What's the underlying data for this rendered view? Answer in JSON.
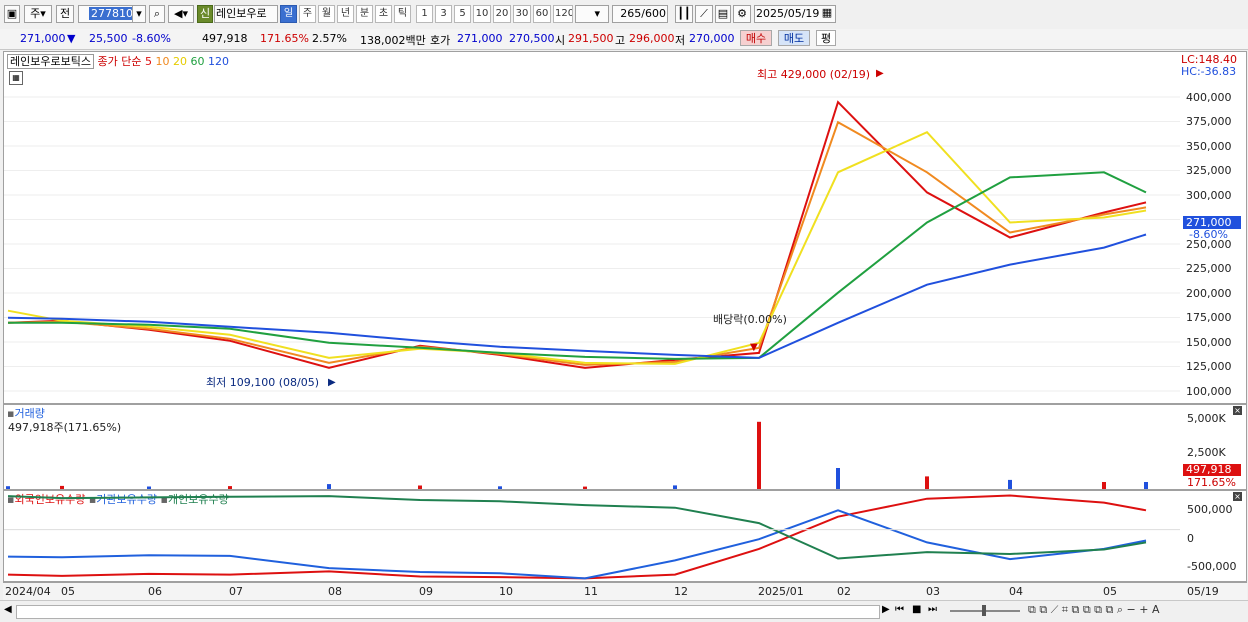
{
  "toolbar": {
    "market_ju": "주",
    "prev_label": "전",
    "code": "277810",
    "flag_shin": "신",
    "stock_name": "레인보우로",
    "periods": [
      "일",
      "주",
      "월",
      "년",
      "분",
      "초",
      "틱"
    ],
    "active_period": "일",
    "intervals": [
      "1",
      "3",
      "5",
      "10",
      "20",
      "30",
      "60",
      "120"
    ],
    "count": "265",
    "count_total": "/600",
    "date": "2025/05/19"
  },
  "quote": {
    "price": "271,000",
    "change": "25,500",
    "change_pct": "-8.60%",
    "volume": "497,918",
    "volume_ratio": "171.65%",
    "turnover_ratio": "2.57%",
    "amount": "138,002백만",
    "hoga_label": "호가",
    "bid": "271,000",
    "ask": "270,500",
    "open_label": "시",
    "open": "291,500",
    "high_label": "고",
    "high": "296,000",
    "low_label": "저",
    "low": "270,000",
    "buy_label": "매수",
    "sell_label": "매도",
    "eval_label": "평"
  },
  "price_pane": {
    "legend_name": "레인보우로보틱스",
    "legend_ma_title": "종가 단순",
    "ma_periods": [
      "5",
      "10",
      "20",
      "60",
      "120"
    ],
    "ma_colors": [
      "#dd1010",
      "#f08a20",
      "#f0e020",
      "#20a040",
      "#2050dd"
    ],
    "lc": "LC:148.40",
    "hc": "HC:-36.83",
    "high_annot": "최고 429,000 (02/19)",
    "low_annot": "최저 109,100 (08/05)",
    "dividend_annot": "배당락(0.00%)",
    "price_tag": "271,000",
    "price_tag_pct": "-8.60%",
    "y_ticks": [
      "400,000",
      "375,000",
      "350,000",
      "325,000",
      "300,000",
      "275,000",
      "250,000",
      "225,000",
      "200,000",
      "175,000",
      "150,000",
      "125,000",
      "100,000"
    ]
  },
  "volume_pane": {
    "title": "거래량",
    "value": "497,918주(171.65%)",
    "y_ticks": [
      "5,000K",
      "2,500K"
    ],
    "tag_value": "497,918",
    "tag_pct": "171.65%"
  },
  "holding_pane": {
    "legend_foreign": "외국인보유수량",
    "legend_inst": "기관보유수량",
    "legend_indiv": "개인보유수량",
    "colors": {
      "foreign": "#dd1010",
      "inst": "#2060dd",
      "indiv": "#208050"
    },
    "y_ticks": [
      "500,000",
      "0",
      "-500,000"
    ]
  },
  "x_axis": [
    "2024/04",
    "05",
    "06",
    "07",
    "08",
    "09",
    "10",
    "11",
    "12",
    "2025/01",
    "02",
    "03",
    "04",
    "05",
    "05/19"
  ],
  "chart_data": [
    {
      "type": "line",
      "title": "레인보우로보틱스 종가 단순",
      "x": [
        "2024/04",
        "05",
        "06",
        "07",
        "08",
        "09",
        "10",
        "11",
        "12",
        "2025/01",
        "02",
        "03",
        "04",
        "05",
        "05/19"
      ],
      "series": [
        {
          "name": "5",
          "values": [
            170000,
            172000,
            163000,
            152000,
            125000,
            147000,
            138000,
            125000,
            133000,
            140000,
            390000,
            300000,
            255000,
            280000,
            290000
          ]
        },
        {
          "name": "10",
          "values": [
            170000,
            171000,
            164000,
            154000,
            130000,
            146000,
            139000,
            128000,
            131000,
            145000,
            370000,
            320000,
            260000,
            278000,
            285000
          ]
        },
        {
          "name": "20",
          "values": [
            182000,
            172000,
            166000,
            158000,
            135000,
            144000,
            140000,
            130000,
            129000,
            150000,
            320000,
            360000,
            270000,
            275000,
            282000
          ]
        },
        {
          "name": "60",
          "values": [
            170000,
            170000,
            168000,
            164000,
            150000,
            145000,
            140000,
            136000,
            134000,
            135000,
            200000,
            270000,
            315000,
            320000,
            300000
          ]
        },
        {
          "name": "120",
          "values": [
            175000,
            174000,
            171000,
            166000,
            160000,
            152000,
            146000,
            142000,
            138000,
            135000,
            170000,
            208000,
            228000,
            245000,
            258000
          ]
        }
      ],
      "ylim": [
        90000,
        440000
      ],
      "annotations": [
        "최고 429,000 (02/19)",
        "최저 109,100 (08/05)",
        "배당락(0.00%)"
      ]
    },
    {
      "type": "bar",
      "title": "거래량",
      "x": [
        "2024/04",
        "05",
        "06",
        "07",
        "08",
        "09",
        "10",
        "11",
        "12",
        "2025/01",
        "02",
        "03",
        "04",
        "05",
        "05/19"
      ],
      "values": [
        200,
        220,
        180,
        210,
        350,
        250,
        190,
        170,
        260,
        4800,
        1500,
        900,
        650,
        500,
        498
      ],
      "ylabel": "K",
      "ylim": [
        0,
        6000
      ]
    },
    {
      "type": "line",
      "title": "보유수량",
      "x": [
        "2024/04",
        "05",
        "06",
        "07",
        "08",
        "09",
        "10",
        "11",
        "12",
        "2025/01",
        "02",
        "03",
        "04",
        "05",
        "05/19"
      ],
      "series": [
        {
          "name": "외국인보유수량",
          "values": [
            -700000,
            -720000,
            -690000,
            -700000,
            -650000,
            -730000,
            -740000,
            -760000,
            -700000,
            -300000,
            200000,
            480000,
            530000,
            420000,
            300000
          ]
        },
        {
          "name": "기관보유수량",
          "values": [
            -420000,
            -430000,
            -400000,
            -410000,
            -600000,
            -660000,
            -680000,
            -760000,
            -480000,
            -150000,
            300000,
            -200000,
            -460000,
            -300000,
            -170000
          ]
        },
        {
          "name": "개인보유수량",
          "values": [
            520000,
            490000,
            500000,
            510000,
            520000,
            460000,
            440000,
            380000,
            340000,
            100000,
            -450000,
            -350000,
            -380000,
            -310000,
            -200000
          ]
        }
      ],
      "ylim": [
        -800000,
        600000
      ]
    }
  ]
}
